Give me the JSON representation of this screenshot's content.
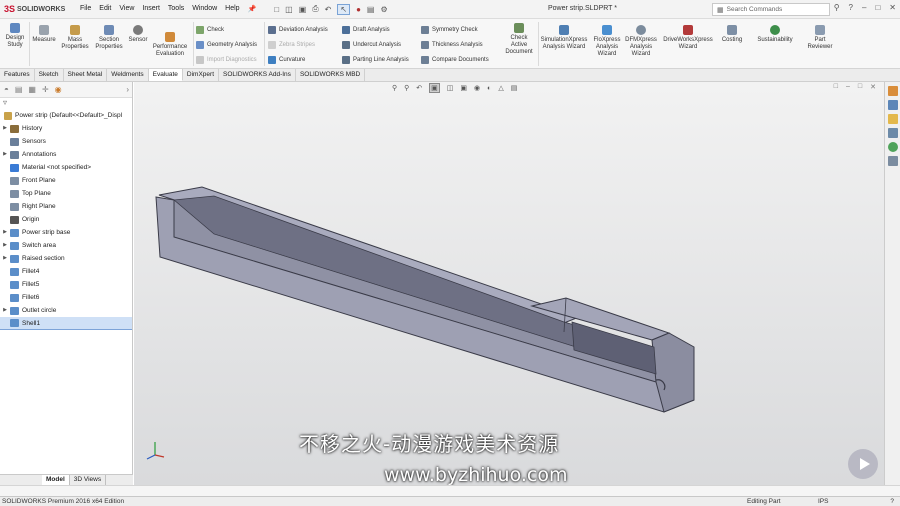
{
  "app": {
    "logo_ds": "3S",
    "logo_text": "SOLIDWORKS"
  },
  "menu": [
    "File",
    "Edit",
    "View",
    "Insert",
    "Tools",
    "Window",
    "Help"
  ],
  "document_title": "Power strip.SLDPRT *",
  "search": {
    "placeholder": "Search Commands"
  },
  "ribbon": {
    "design_study": "Design Study",
    "measure": "Measure",
    "mass_properties": "Mass Properties",
    "section_properties": "Section Properties",
    "sensor": "Sensor",
    "performance_evaluation": "Performance Evaluation",
    "check": "Check",
    "geometry_analysis": "Geometry Analysis",
    "import_diagnostics": "Import Diagnostics",
    "deviation_analysis": "Deviation Analysis",
    "zebra_stripes": "Zebra Stripes",
    "curvature": "Curvature",
    "draft_analysis": "Draft Analysis",
    "undercut_analysis": "Undercut Analysis",
    "parting_line_analysis": "Parting Line Analysis",
    "symmetry_check": "Symmetry Check",
    "thickness_analysis": "Thickness Analysis",
    "compare_documents": "Compare Documents",
    "check_active_document": "Check Active Document",
    "simulationxpress": "SimulationXpress Analysis Wizard",
    "floxpress": "FloXpress Analysis Wizard",
    "dfmxpress": "DFMXpress Analysis Wizard",
    "driveworksxpress": "DriveWorksXpress Wizard",
    "costing": "Costing",
    "sustainability": "Sustainability",
    "part_reviewer": "Part Reviewer"
  },
  "tabs": [
    "Features",
    "Sketch",
    "Sheet Metal",
    "Weldments",
    "Evaluate",
    "DimXpert",
    "SOLIDWORKS Add-Ins",
    "SOLIDWORKS MBD"
  ],
  "active_tab": "Evaluate",
  "tree": {
    "root": "Power strip  (Default<<Default>_Displ",
    "items": [
      {
        "label": "History",
        "expandable": true,
        "selected": false,
        "color": "#8a6d3b"
      },
      {
        "label": "Sensors",
        "expandable": false,
        "selected": false,
        "color": "#6a7f9a"
      },
      {
        "label": "Annotations",
        "expandable": true,
        "selected": false,
        "color": "#6a7f9a"
      },
      {
        "label": "Material <not specified>",
        "expandable": false,
        "selected": false,
        "color": "#3a7bd5"
      },
      {
        "label": "Front Plane",
        "expandable": false,
        "selected": false,
        "color": "#7d8ea3"
      },
      {
        "label": "Top Plane",
        "expandable": false,
        "selected": false,
        "color": "#7d8ea3"
      },
      {
        "label": "Right Plane",
        "expandable": false,
        "selected": false,
        "color": "#7d8ea3"
      },
      {
        "label": "Origin",
        "expandable": false,
        "selected": false,
        "color": "#555555"
      },
      {
        "label": "Power strip base",
        "expandable": true,
        "selected": false,
        "color": "#5b8ec9"
      },
      {
        "label": "Switch area",
        "expandable": true,
        "selected": false,
        "color": "#5b8ec9"
      },
      {
        "label": "Raised section",
        "expandable": true,
        "selected": false,
        "color": "#5b8ec9"
      },
      {
        "label": "Fillet4",
        "expandable": false,
        "selected": false,
        "color": "#5b8ec9"
      },
      {
        "label": "Fillet5",
        "expandable": false,
        "selected": false,
        "color": "#5b8ec9"
      },
      {
        "label": "Fillet6",
        "expandable": false,
        "selected": false,
        "color": "#5b8ec9"
      },
      {
        "label": "Outlet circle",
        "expandable": true,
        "selected": false,
        "color": "#5b8ec9"
      },
      {
        "label": "Shell1",
        "expandable": false,
        "selected": true,
        "color": "#5b8ec9"
      }
    ]
  },
  "bottom_tabs": [
    "Model",
    "3D Views"
  ],
  "watermark": {
    "line1": "不移之火-动漫游戏美术资源",
    "line2": "www.byzhihuo.com"
  },
  "status": {
    "left": "SOLIDWORKS Premium 2016 x64 Edition",
    "mode": "Editing Part",
    "units": "IPS"
  },
  "colors": {
    "model": "#9a9cae",
    "model_dark": "#5b5d70",
    "accent": "#c8102e"
  }
}
